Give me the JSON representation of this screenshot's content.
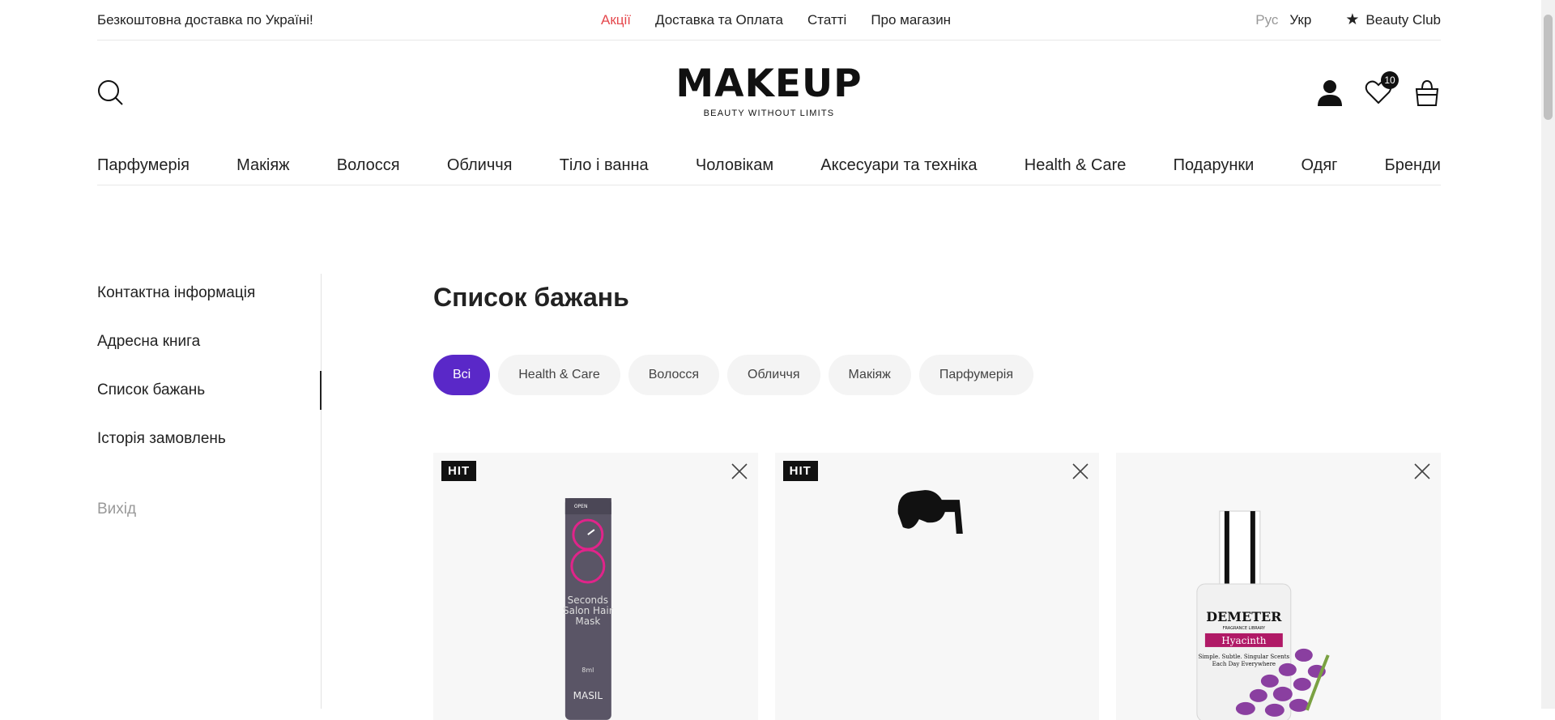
{
  "topbar": {
    "promo": "Безкоштовна доставка по Україні!",
    "links": [
      "Акції",
      "Доставка та Оплата",
      "Статті",
      "Про магазин"
    ],
    "sale_color": "#e5484d",
    "lang_ru": "Рус",
    "lang_uk": "Укр",
    "beauty_club": "Beauty Club"
  },
  "header": {
    "logo": "MAKEUP",
    "tagline": "BEAUTY WITHOUT LIMITS",
    "wishlist_count": "10"
  },
  "main_nav": [
    "Парфумерія",
    "Макіяж",
    "Волосся",
    "Обличчя",
    "Тіло і ванна",
    "Чоловікам",
    "Аксесуари та техніка",
    "Health & Care",
    "Подарунки",
    "Одяг",
    "Бренди"
  ],
  "sidebar": {
    "items": [
      "Контактна інформація",
      "Адресна книга",
      "Список бажань",
      "Історія замовлень"
    ],
    "logout": "Вихід"
  },
  "content": {
    "title": "Список бажань",
    "filters": [
      "Всі",
      "Health & Care",
      "Волосся",
      "Обличчя",
      "Макіяж",
      "Парфумерія"
    ],
    "accent": "#5a28c8"
  },
  "products": [
    {
      "badge": "HIT",
      "image": "masil-8-seconds-salon-hair-mask-icon",
      "pack_text_1": "Seconds",
      "pack_text_2": "Salon Hair",
      "pack_text_3": "Mask",
      "pack_size": "8ml",
      "pack_brand": "MASIL",
      "pack_open": "OPEN"
    },
    {
      "badge": "HIT",
      "image": "black-spray-device-icon"
    },
    {
      "badge": "",
      "image": "demeter-hyacinth-perfume-icon",
      "pack_brand": "DEMETER",
      "pack_sub": "FRAGRANCE LIBRARY",
      "pack_name": "Hyacinth",
      "pack_line": "Simple. Subtle. Singular Scents",
      "pack_line2": "Each Day Everywhere"
    }
  ]
}
